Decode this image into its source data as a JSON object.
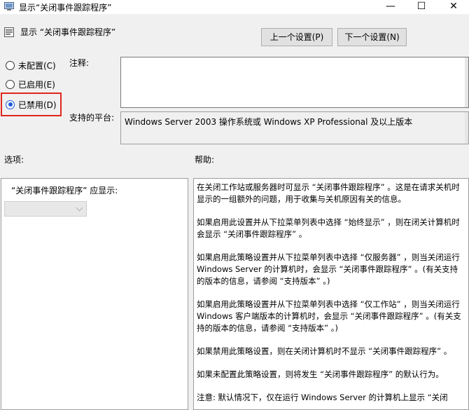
{
  "window": {
    "title": "显示“关闭事件跟踪程序”",
    "minimize_glyph": "—",
    "maximize_glyph": "☐",
    "close_glyph": "✕"
  },
  "header": {
    "title": "显示 “关闭事件跟踪程序”"
  },
  "nav": {
    "prev_label": "上一个设置(P)",
    "next_label": "下一个设置(N)"
  },
  "state_options": [
    {
      "label": "未配置(C)",
      "checked": false
    },
    {
      "label": "已启用(E)",
      "checked": false
    },
    {
      "label": "已禁用(D)",
      "checked": true
    }
  ],
  "comment": {
    "label": "注释:",
    "value": ""
  },
  "platform": {
    "label": "支持的平台:",
    "value": "Windows Server 2003 操作系统或 Windows XP Professional 及以上版本"
  },
  "options": {
    "heading": "选项:",
    "field_label": "“关闭事件跟踪程序” 应显示:",
    "dropdown_value": ""
  },
  "help": {
    "heading": "帮助:",
    "paragraphs": [
      "在关闭工作站或服务器时可显示 “关闭事件跟踪程序” 。这是在请求关机时显示的一组额外的问题，用于收集与关机原因有关的信息。",
      "如果启用此设置并从下拉菜单列表中选择 “始终显示” ，则在闭关计算机时会显示 “关闭事件跟踪程序” 。",
      "如果启用此策略设置并从下拉菜单列表中选择 “仅服务器” ，则当关闭运行 Windows Server 的计算机时，会显示 “关闭事件跟踪程序” 。(有关支持的版本的信息，请参阅 “支持版本” 。)",
      "如果启用此策略设置并从下拉菜单列表中选择 “仅工作站” ，则当关闭运行 Windows 客户端版本的计算机时，会显示 “关闭事件跟踪程序” 。(有关支持的版本的信息，请参阅 “支持版本” 。)",
      "如果禁用此策略设置，则在关闭计算机时不显示 “关闭事件跟踪程序” 。",
      "如果未配置此策略设置，则将发生 “关闭事件跟踪程序” 的默认行为。",
      "注意: 默认情况下，仅在运行 Windows Server 的计算机上显示 “关闭"
    ]
  },
  "colors": {
    "highlight": "#e0271d",
    "radio_accent": "#1e5bd6",
    "window_bg": "#f0f0f0"
  }
}
